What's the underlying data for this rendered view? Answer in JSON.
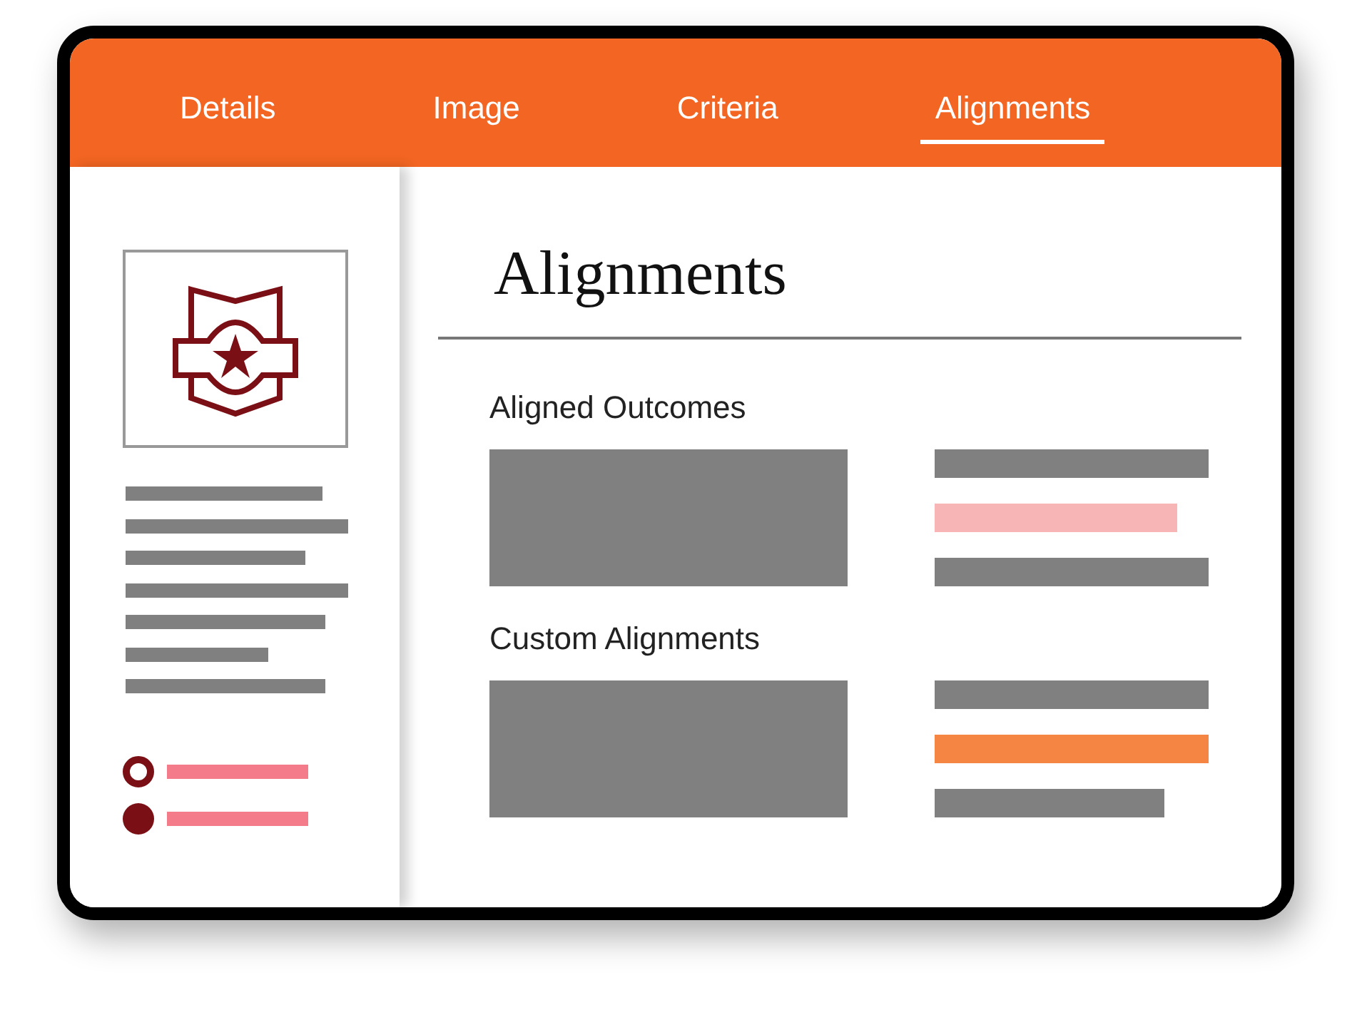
{
  "tabs": [
    {
      "label": "Details",
      "selected": false
    },
    {
      "label": "Image",
      "selected": false
    },
    {
      "label": "Criteria",
      "selected": false
    },
    {
      "label": "Alignments",
      "selected": true
    }
  ],
  "sidebar": {
    "options": [
      {
        "kind": "ring"
      },
      {
        "kind": "dot"
      }
    ]
  },
  "content": {
    "title": "Alignments",
    "sections": [
      {
        "heading": "Aligned Outcomes",
        "lines": [
          {
            "color": "#808080"
          },
          {
            "color": "#f7b5b5"
          },
          {
            "color": "#808080"
          }
        ]
      },
      {
        "heading": "Custom Alignments",
        "lines": [
          {
            "color": "#808080"
          },
          {
            "color": "#f58542"
          },
          {
            "color": "#808080"
          }
        ]
      }
    ]
  }
}
